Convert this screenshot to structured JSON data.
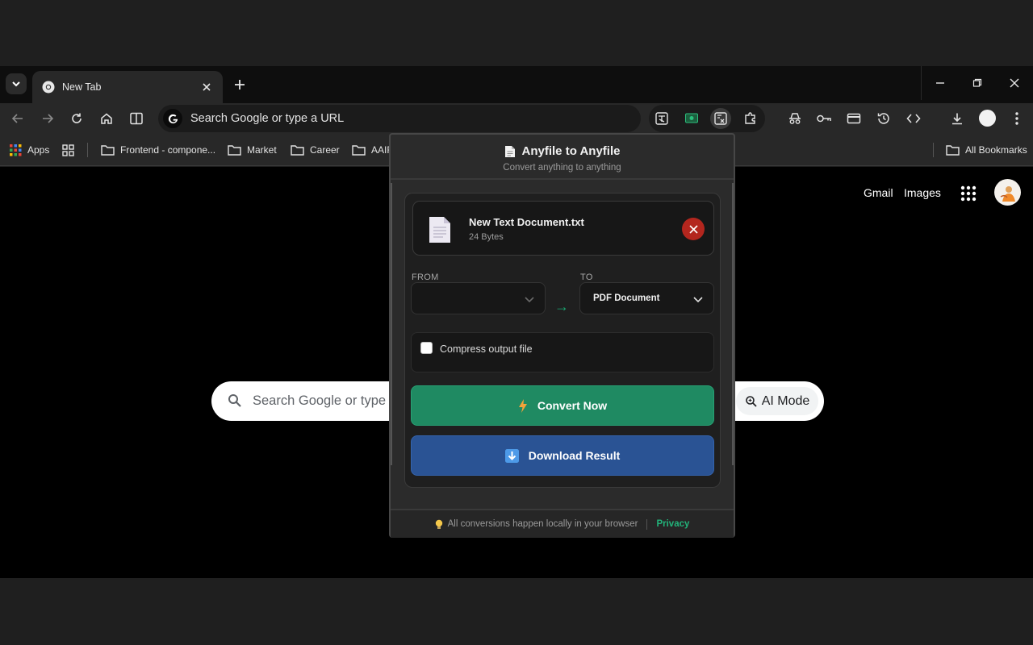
{
  "browser": {
    "tab": {
      "title": "New Tab"
    },
    "omnibox": {
      "placeholder": "Search Google or type a URL"
    },
    "bookmarks": [
      {
        "label": "Apps"
      },
      {
        "label": "Frontend - compone..."
      },
      {
        "label": "Market"
      },
      {
        "label": "Career"
      },
      {
        "label": "AAIF"
      }
    ],
    "all_bookmarks": "All Bookmarks"
  },
  "page": {
    "gmail": "Gmail",
    "images": "Images",
    "search_placeholder": "Search Google or type a",
    "ai_mode": "AI Mode"
  },
  "popup": {
    "title": "Anyfile to Anyfile",
    "subtitle": "Convert anything to anything",
    "file": {
      "name": "New Text Document.txt",
      "size": "24 Bytes"
    },
    "from_label": "FROM",
    "to_label": "TO",
    "from_value": "",
    "to_value": "PDF Document",
    "compress_label": "Compress output file",
    "convert_label": "Convert Now",
    "download_label": "Download Result",
    "footer_text": "All conversions happen locally in your browser",
    "privacy_label": "Privacy"
  },
  "colors": {
    "convert": "#1f8a62",
    "download": "#2a5394",
    "remove": "#b3261e",
    "privacy": "#22b37a"
  }
}
